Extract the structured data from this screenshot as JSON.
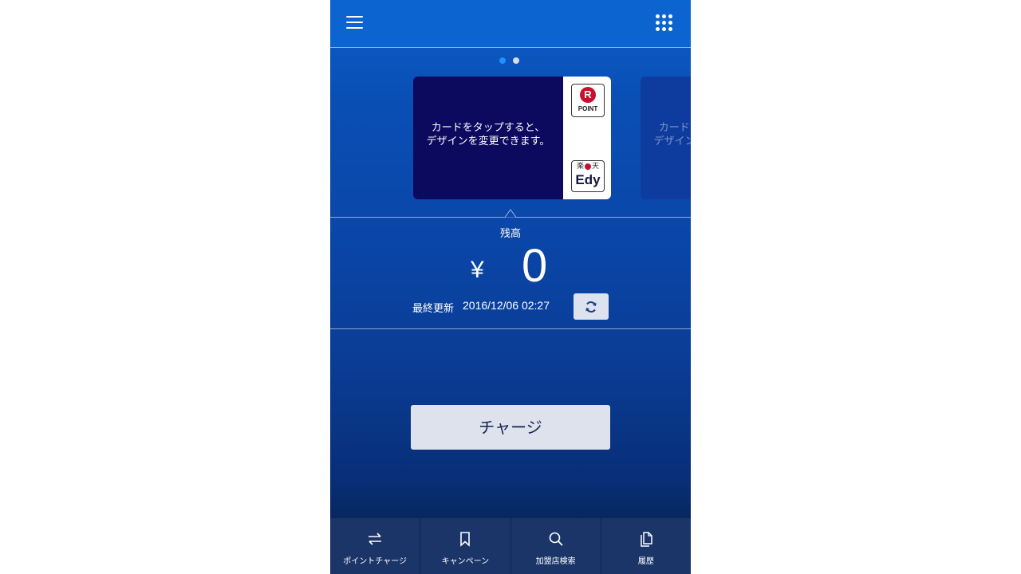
{
  "header": {
    "menu_icon": "hamburger-menu-icon",
    "apps_icon": "grid-apps-icon"
  },
  "pager": {
    "count": 2,
    "active_index": 0,
    "active_color": "#1e90ff",
    "inactive_color": "#d9dde6"
  },
  "card": {
    "hint_line1": "カードをタップすると、",
    "hint_line2": "デザインを変更できます。",
    "rpoint_letter": "R",
    "rpoint_text": "POINT",
    "edy_kanji_1": "楽",
    "edy_kanji_2": "天",
    "edy_text": "Edy"
  },
  "next_card": {
    "hint_line1": "カードをタップすると、",
    "hint_line2": "デザインを変更できます。"
  },
  "balance": {
    "label": "残高",
    "currency": "¥",
    "amount": "0",
    "updated_label": "最終更新",
    "updated_time": "2016/12/06 02:27",
    "refresh_icon": "refresh-icon"
  },
  "actions": {
    "charge_label": "チャージ"
  },
  "bottom_nav": [
    {
      "label": "ポイントチャージ",
      "icon": "exchange-arrows-icon"
    },
    {
      "label": "キャンペーン",
      "icon": "bookmark-icon"
    },
    {
      "label": "加盟店検索",
      "icon": "search-icon"
    },
    {
      "label": "履歴",
      "icon": "history-docs-icon"
    }
  ],
  "colors": {
    "accent": "#0b64cf",
    "card_bg": "#0c0a5e",
    "button_bg": "#dde2ec",
    "nav_bg": "#1b3569",
    "brand_red": "#c8102e"
  }
}
